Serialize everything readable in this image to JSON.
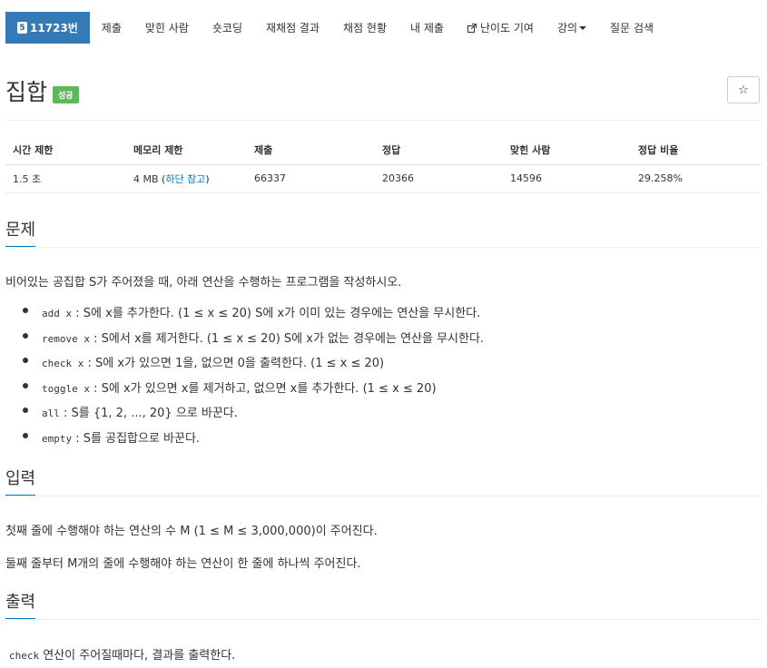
{
  "nav": {
    "problem_number": "11723번",
    "tier_badge": "5",
    "items": [
      "제출",
      "맞힌 사람",
      "숏코딩",
      "재채점 결과",
      "채점 현황",
      "내 제출",
      "난이도 기여",
      "강의",
      "질문 검색"
    ]
  },
  "title": {
    "text": "집합",
    "status": "성공",
    "star": "☆"
  },
  "table": {
    "headers": [
      "시간 제한",
      "메모리 제한",
      "제출",
      "정답",
      "맞힌 사람",
      "정답 비율"
    ],
    "time": "1.5 초",
    "memory_prefix": "4 MB (",
    "memory_link": "하단 참고",
    "memory_suffix": ")",
    "submissions": "66337",
    "correct": "20366",
    "solvers": "14596",
    "ratio": "29.258%"
  },
  "problem": {
    "heading": "문제",
    "intro": "비어있는 공집합 S가 주어졌을 때, 아래 연산을 수행하는 프로그램을 작성하시오.",
    "ops": [
      {
        "code": "add x",
        "desc": ": S에 x를 추가한다. (1 ≤ x ≤ 20) S에 x가 이미 있는 경우에는 연산을 무시한다."
      },
      {
        "code": "remove x",
        "desc": ": S에서 x를 제거한다. (1 ≤ x ≤ 20) S에 x가 없는 경우에는 연산을 무시한다."
      },
      {
        "code": "check x",
        "desc": ": S에 x가 있으면 1을, 없으면 0을 출력한다. (1 ≤ x ≤ 20)"
      },
      {
        "code": "toggle x",
        "desc": ": S에 x가 있으면 x를 제거하고, 없으면 x를 추가한다. (1 ≤ x ≤ 20)"
      },
      {
        "code": "all",
        "desc": ": S를 {1, 2, ..., 20} 으로 바꾼다."
      },
      {
        "code": "empty",
        "desc": ": S를 공집합으로 바꾼다."
      }
    ]
  },
  "input": {
    "heading": "입력",
    "line1": "첫째 줄에 수행해야 하는 연산의 수 M (1 ≤ M ≤ 3,000,000)이 주어진다.",
    "line2": "둘째 줄부터 M개의 줄에 수행해야 하는 연산이 한 줄에 하나씩 주어진다."
  },
  "output": {
    "heading": "출력",
    "code": "check",
    "text": "연산이 주어질때마다, 결과를 출력한다."
  },
  "colors": {
    "primary": "#337ab7",
    "success": "#5cb85c",
    "link": "#0076c0"
  }
}
